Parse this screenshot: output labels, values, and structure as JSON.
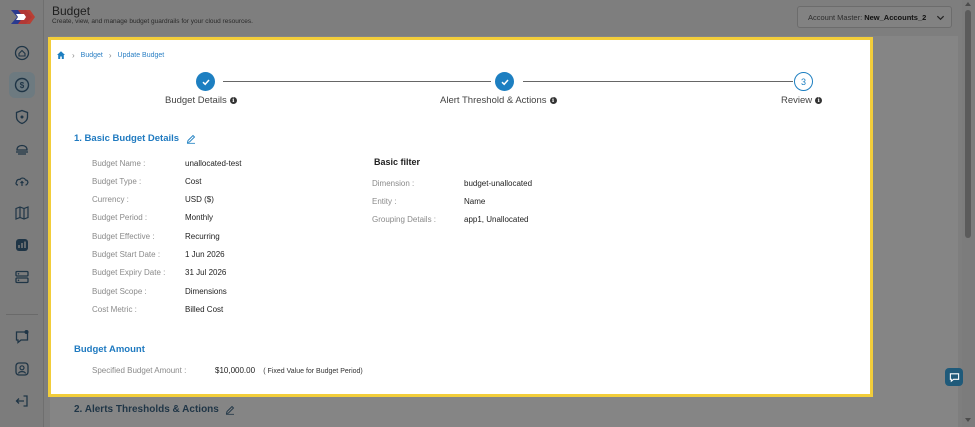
{
  "header": {
    "title": "Budget",
    "subtitle": "Create, view, and manage budget guardrails for your cloud resources.",
    "account_label": "Account Master:",
    "account_value": "New_Accounts_2"
  },
  "sidebar": {
    "icons": [
      "home-icon",
      "budget-dollar-icon",
      "shield-icon",
      "cloud-stack-icon",
      "cloud-upload-icon",
      "map-icon",
      "chart-icon",
      "server-icon",
      "chat-icon",
      "user-icon",
      "logout-icon"
    ]
  },
  "breadcrumb": {
    "items": [
      "Budget",
      "Update Budget"
    ]
  },
  "stepper": {
    "steps": [
      {
        "label": "Budget Details",
        "state": "done"
      },
      {
        "label": "Alert Threshold & Actions",
        "state": "done"
      },
      {
        "label": "Review",
        "state": "pending",
        "number": "3"
      }
    ]
  },
  "basic_details": {
    "title": "1. Basic Budget Details",
    "fields": [
      {
        "label": "Budget Name :",
        "value": "unallocated-test"
      },
      {
        "label": "Budget Type :",
        "value": "Cost"
      },
      {
        "label": "Currency :",
        "value": "USD ($)"
      },
      {
        "label": "Budget Period :",
        "value": "Monthly"
      },
      {
        "label": "Budget Effective :",
        "value": "Recurring"
      },
      {
        "label": "Budget Start Date :",
        "value": "1 Jun 2026"
      },
      {
        "label": "Budget Expiry Date :",
        "value": "31 Jul 2026"
      },
      {
        "label": "Budget Scope :",
        "value": "Dimensions"
      },
      {
        "label": "Cost Metric :",
        "value": "Billed Cost"
      }
    ]
  },
  "basic_filter": {
    "title": "Basic filter",
    "fields": [
      {
        "label": "Dimension :",
        "value": "budget-unallocated"
      },
      {
        "label": "Entity :",
        "value": "Name"
      },
      {
        "label": "Grouping Details :",
        "value": "app1, Unallocated"
      }
    ]
  },
  "budget_amount": {
    "title": "Budget Amount",
    "label": "Specified Budget Amount :",
    "value": "$10,000.00",
    "note": "( Fixed Value for Budget Period)"
  },
  "section2": {
    "title": "2. Alerts Thresholds & Actions"
  },
  "colors": {
    "accent": "#1d7fc1",
    "highlight_border": "#f2cd3a"
  }
}
